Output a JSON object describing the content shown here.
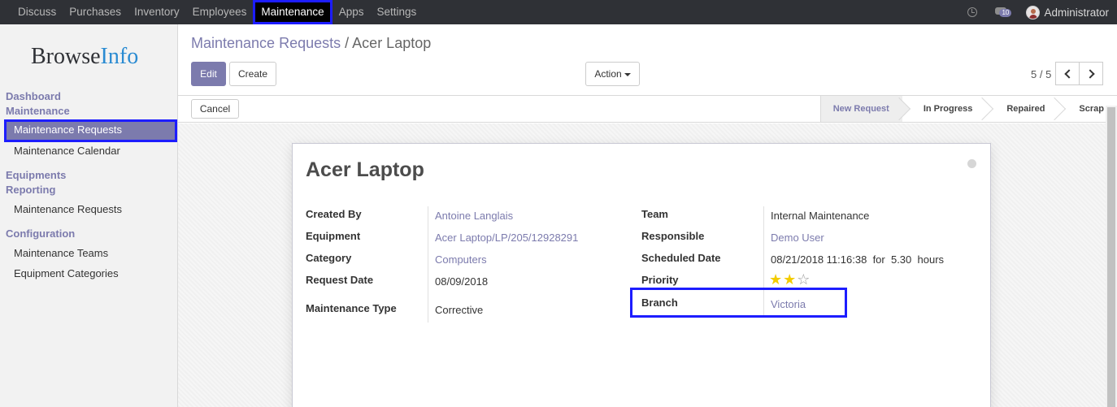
{
  "topbar": {
    "menu": [
      "Discuss",
      "Purchases",
      "Inventory",
      "Employees",
      "Maintenance",
      "Apps",
      "Settings"
    ],
    "active": "Maintenance",
    "message_count": "10",
    "user": "Administrator"
  },
  "sidebar": {
    "logo": {
      "browse": "Browse",
      "info": "Info"
    },
    "sections": {
      "dashboard": "Dashboard",
      "maintenance": "Maintenance",
      "equipments": "Equipments",
      "reporting": "Reporting",
      "configuration": "Configuration"
    },
    "items": {
      "maintenance_requests": "Maintenance Requests",
      "maintenance_calendar": "Maintenance Calendar",
      "reporting_requests": "Maintenance Requests",
      "maintenance_teams": "Maintenance Teams",
      "equipment_categories": "Equipment Categories"
    }
  },
  "breadcrumb": {
    "parent": "Maintenance Requests",
    "separator": "/",
    "current": "Acer Laptop"
  },
  "buttons": {
    "edit": "Edit",
    "create": "Create",
    "action": "Action",
    "cancel": "Cancel"
  },
  "pager": "5 / 5",
  "stages": [
    "New Request",
    "In Progress",
    "Repaired",
    "Scrap"
  ],
  "current_stage": "New Request",
  "record": {
    "title": "Acer Laptop",
    "left": [
      {
        "label": "Created By",
        "value": "Antoine Langlais"
      },
      {
        "label": "Equipment",
        "value": "Acer Laptop/LP/205/12928291"
      },
      {
        "label": "Category",
        "value": "Computers"
      },
      {
        "label": "Request Date",
        "value": "08/09/2018"
      },
      {
        "label": "Maintenance Type",
        "value": "Corrective"
      }
    ],
    "right": [
      {
        "label": "Team",
        "value": "Internal Maintenance"
      },
      {
        "label": "Responsible",
        "value": "Demo User"
      },
      {
        "label": "Scheduled Date",
        "value": "08/21/2018 11:16:38",
        "for": "for",
        "duration": "5.30",
        "unit": "hours"
      },
      {
        "label": "Priority",
        "stars": 2,
        "max_stars": 3
      },
      {
        "label": "Branch",
        "value": "Victoria"
      }
    ]
  },
  "colors": {
    "accent": "#7c7bad",
    "highlight": "#1d1dff",
    "star": "#f3cc00"
  }
}
